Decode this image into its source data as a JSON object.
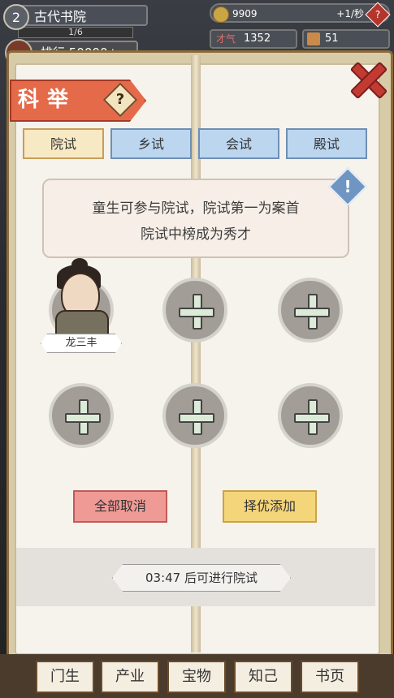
{
  "header": {
    "level": "2",
    "academy_name": "古代书院",
    "progress": "1/6",
    "rank": "排行 50000+"
  },
  "resources": {
    "coins": "9909",
    "coins_rate": "+1/秒",
    "talent_label": "才气",
    "talent_value": "1352",
    "books_value": "51"
  },
  "panel": {
    "title": "科举",
    "tabs": [
      "院试",
      "乡试",
      "会试",
      "殿试"
    ],
    "active_tab": "院试",
    "info_lines": [
      "童生可参与院试，院试第一为案首",
      "院试中榜成为秀才"
    ],
    "student_name": "龙三丰",
    "cancel_all_label": "全部取消",
    "auto_add_label": "择优添加",
    "timer_text": "03:47 后可进行院试"
  },
  "bottom_nav": {
    "items": [
      "门生",
      "产业",
      "宝物",
      "知己",
      "书页"
    ]
  },
  "colors": {
    "active_tab_bg": "#f7e9c4",
    "inactive_tab_bg": "#bcd6f0",
    "cancel_button_bg": "#f09a96",
    "add_button_bg": "#f5d57a",
    "title_banner_bg": "#e56a4a"
  }
}
